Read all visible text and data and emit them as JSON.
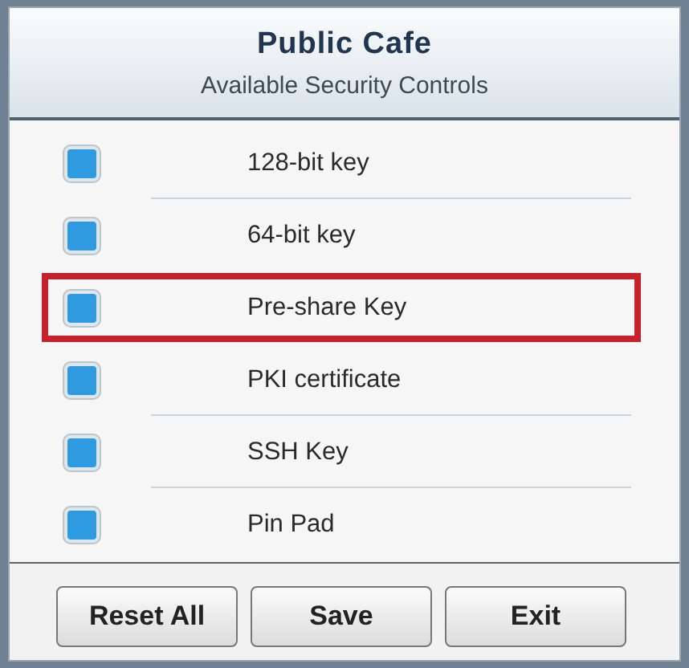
{
  "header": {
    "title": "Public Cafe",
    "subtitle": "Available Security Controls"
  },
  "options": [
    {
      "label": "128-bit key",
      "checked": true,
      "highlighted": false
    },
    {
      "label": "64-bit key",
      "checked": true,
      "highlighted": false
    },
    {
      "label": "Pre-share Key",
      "checked": true,
      "highlighted": true
    },
    {
      "label": "PKI certificate",
      "checked": true,
      "highlighted": false
    },
    {
      "label": "SSH Key",
      "checked": true,
      "highlighted": false
    },
    {
      "label": "Pin Pad",
      "checked": true,
      "highlighted": false
    }
  ],
  "buttons": [
    "Reset All",
    "Save",
    "Exit"
  ]
}
